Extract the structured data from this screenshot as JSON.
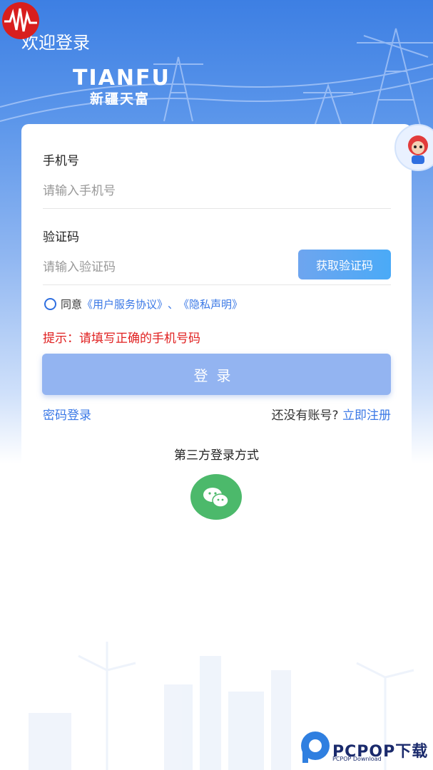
{
  "header": {
    "welcome": "欢迎登录",
    "brand_en": "TIANFU",
    "brand_cn": "新疆天富"
  },
  "form": {
    "phone_label": "手机号",
    "phone_placeholder": "请输入手机号",
    "code_label": "验证码",
    "code_placeholder": "请输入验证码",
    "get_code_button": "获取验证码",
    "agree_prefix": "同意",
    "user_agreement": "《用户服务协议》",
    "separator": "、",
    "privacy": "《隐私声明》",
    "hint": "提示：请填写正确的手机号码",
    "login_button": "登录"
  },
  "footer_links": {
    "password_login": "密码登录",
    "no_account": "还没有账号?",
    "register": "立即注册"
  },
  "third_party": {
    "title": "第三方登录方式",
    "icon": "wechat-icon"
  },
  "watermark": {
    "text": "PCPOP下载",
    "sub": "PCPOP Download"
  },
  "colors": {
    "primary": "#3a78e6",
    "error": "#e02020",
    "wechat": "#4cb96b"
  }
}
